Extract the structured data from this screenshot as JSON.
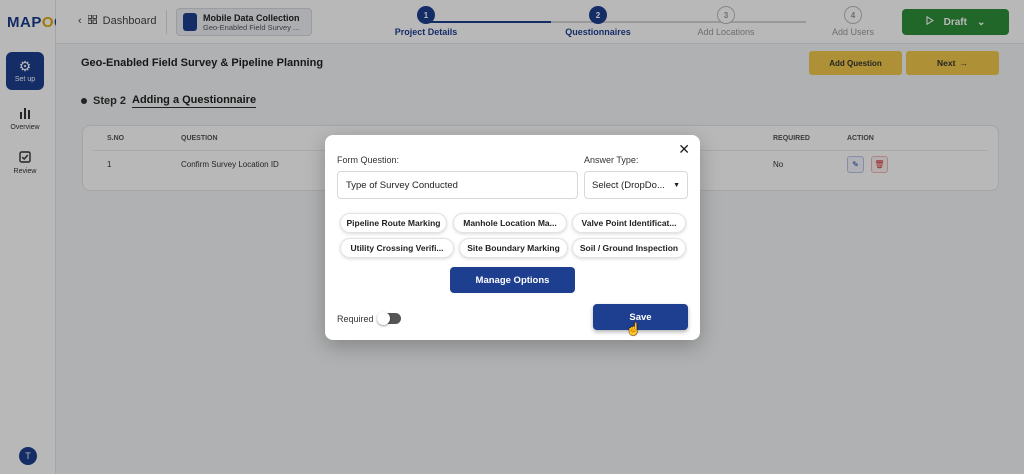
{
  "logo": {
    "text_a": "MAP",
    "text_o": "O",
    "text_b": "G"
  },
  "sidebar": {
    "items": [
      {
        "label": "Set up",
        "icon": "gear-icon",
        "active": true
      },
      {
        "label": "Overview",
        "icon": "bar-chart-icon",
        "active": false
      },
      {
        "label": "Review",
        "icon": "checkbox-icon",
        "active": false
      }
    ],
    "avatar": "T"
  },
  "topbar": {
    "back_label": "Dashboard",
    "project_title": "Mobile Data Collection",
    "project_subtitle": "Geo-Enabled Field Survey ...",
    "steps": [
      {
        "num": "1",
        "label": "Project Details",
        "status": "done"
      },
      {
        "num": "2",
        "label": "Questionnaires",
        "status": "done"
      },
      {
        "num": "3",
        "label": "Add Locations",
        "status": "todo"
      },
      {
        "num": "4",
        "label": "Add Users",
        "status": "todo"
      }
    ],
    "draft_label": "Draft"
  },
  "page": {
    "title": "Geo-Enabled Field Survey & Pipeline Planning",
    "add_question_label": "Add Question",
    "next_label": "Next",
    "step_num": "Step 2",
    "step_title": "Adding a Questionnaire"
  },
  "table": {
    "headers": {
      "sno": "S.NO",
      "question": "QUESTION",
      "required": "REQUIRED",
      "action": "ACTION"
    },
    "rows": [
      {
        "sno": "1",
        "question": "Confirm Survey Location ID",
        "required": "No"
      }
    ]
  },
  "modal": {
    "form_question_label": "Form Question:",
    "form_question_value": "Type of Survey Conducted",
    "answer_type_label": "Answer Type:",
    "answer_type_value": "Select (DropDo...",
    "options": [
      "Pipeline Route Marking",
      "Manhole Location Ma...",
      "Valve Point Identificat...",
      "Utility Crossing Verifi...",
      "Site Boundary Marking",
      "Soil / Ground Inspection"
    ],
    "manage_options_label": "Manage Options",
    "required_label": "Required",
    "save_label": "Save"
  },
  "colors": {
    "primary": "#1e3f8f",
    "accent": "#f2c94c",
    "draft": "#2f8f3a"
  }
}
